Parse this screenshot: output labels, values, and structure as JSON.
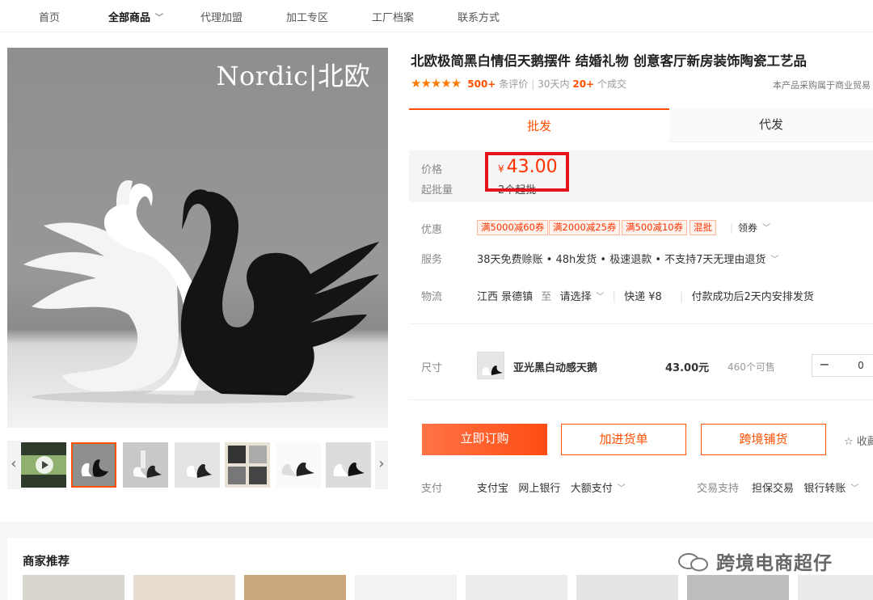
{
  "nav": {
    "items": [
      "首页",
      "全部商品",
      "代理加盟",
      "加工专区",
      "工厂档案",
      "联系方式"
    ]
  },
  "gallery": {
    "brand_logo": "Nordic|北欧",
    "thumbnails": [
      "video-thumb",
      "black-white-swans",
      "white-swans-vase",
      "swans-room",
      "product-grid",
      "swans-white",
      "swans-black-white"
    ]
  },
  "product": {
    "title": "北欧极简黑白情侣天鹅摆件 结婚礼物 创意客厅新房装饰陶瓷工艺品",
    "stars": "★★★★★",
    "reviews_count": "500+",
    "reviews_label": "条评价",
    "period_label": "30天内",
    "sales_count": "20+",
    "sales_label": "个成交",
    "notice": "本产品采购属于商业贸易"
  },
  "tabs": [
    "批发",
    "代发"
  ],
  "price": {
    "price_label": "价格",
    "currency": "¥",
    "value": "43.00",
    "min_order_label": "起批量",
    "min_order": "2个起批"
  },
  "promo": {
    "label": "优惠",
    "coupons": [
      "满5000减60券",
      "满2000减25券",
      "满500减10券",
      "混批"
    ],
    "claim": "领券"
  },
  "service": {
    "label": "服务",
    "text": "38天免费赊账 • 48h发货 • 极速退款 • 不支持7天无理由退货"
  },
  "logistics": {
    "label": "物流",
    "origin": "江西 景德镇",
    "to": "至",
    "destination": "请选择",
    "shipping": "快递 ¥8",
    "dispatch": "付款成功后2天内安排发货"
  },
  "sku": {
    "label": "尺寸",
    "name": "亚光黑白动感天鹅",
    "price": "43.00元",
    "stock": "460个可售",
    "minus": "−",
    "quantity": "0"
  },
  "actions": {
    "buy": "立即订购",
    "cart": "加进货单",
    "cross_border": "跨境铺货",
    "favorite": "☆ 收藏"
  },
  "payment": {
    "label": "支付",
    "methods": "支付宝   网上银行   大额支付",
    "trade_label": "交易支持",
    "trade_methods": "担保交易   银行转账"
  },
  "recommend": {
    "title": "商家推荐",
    "watermark": "跨境电商超仔"
  },
  "colors": {
    "accent": "#ff5000",
    "price_red": "#ff3300",
    "highlight_box": "#e4141a"
  }
}
